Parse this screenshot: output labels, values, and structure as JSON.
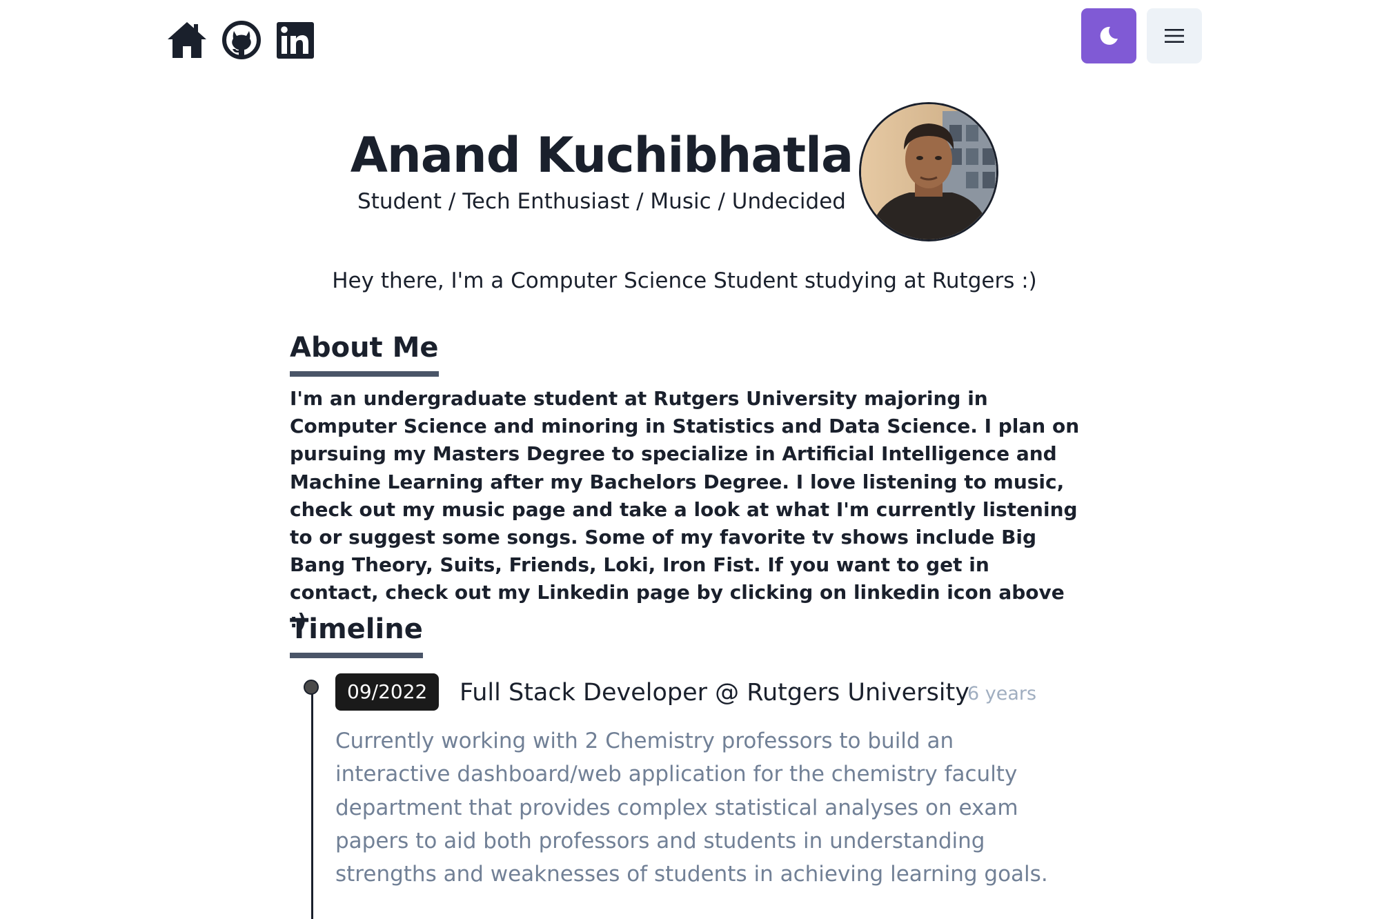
{
  "nav": {
    "icons": [
      "home-icon",
      "github-icon",
      "linkedin-icon"
    ],
    "theme_button_icon": "moon-icon",
    "menu_button_icon": "hamburger-menu-icon",
    "theme_color": "#805ad5"
  },
  "hero": {
    "name": "Anand Kuchibhatla",
    "tagline": "Student / Tech Enthusiast / Music / Undecided"
  },
  "intro": "Hey there, I'm a Computer Science Student studying at Rutgers :)",
  "about": {
    "heading": "About Me",
    "text": "I'm an undergraduate student at Rutgers University majoring in Computer Science and minoring in Statistics and Data Science. I plan on pursuing my Masters Degree to specialize in Artificial Intelligence and Machine Learning after my Bachelors Degree. I love listening to music, check out my music page and take a look at what I'm currently listening to or suggest some songs. Some of my favorite tv shows include Big Bang Theory, Suits, Friends, Loki, Iron Fist. If you want to get in contact, check out my Linkedin page by clicking on linkedin icon above :)"
  },
  "timeline": {
    "heading": "Timeline",
    "items": [
      {
        "date": "09/2022",
        "title": "Full Stack Developer @ Rutgers University",
        "duration": "6 years",
        "description": "Currently working with 2 Chemistry professors to build an interactive dashboard/web application for the chemistry faculty department that provides complex statistical analyses on exam papers to aid both professors and students in understanding strengths and weaknesses of students in achieving learning goals."
      }
    ]
  }
}
